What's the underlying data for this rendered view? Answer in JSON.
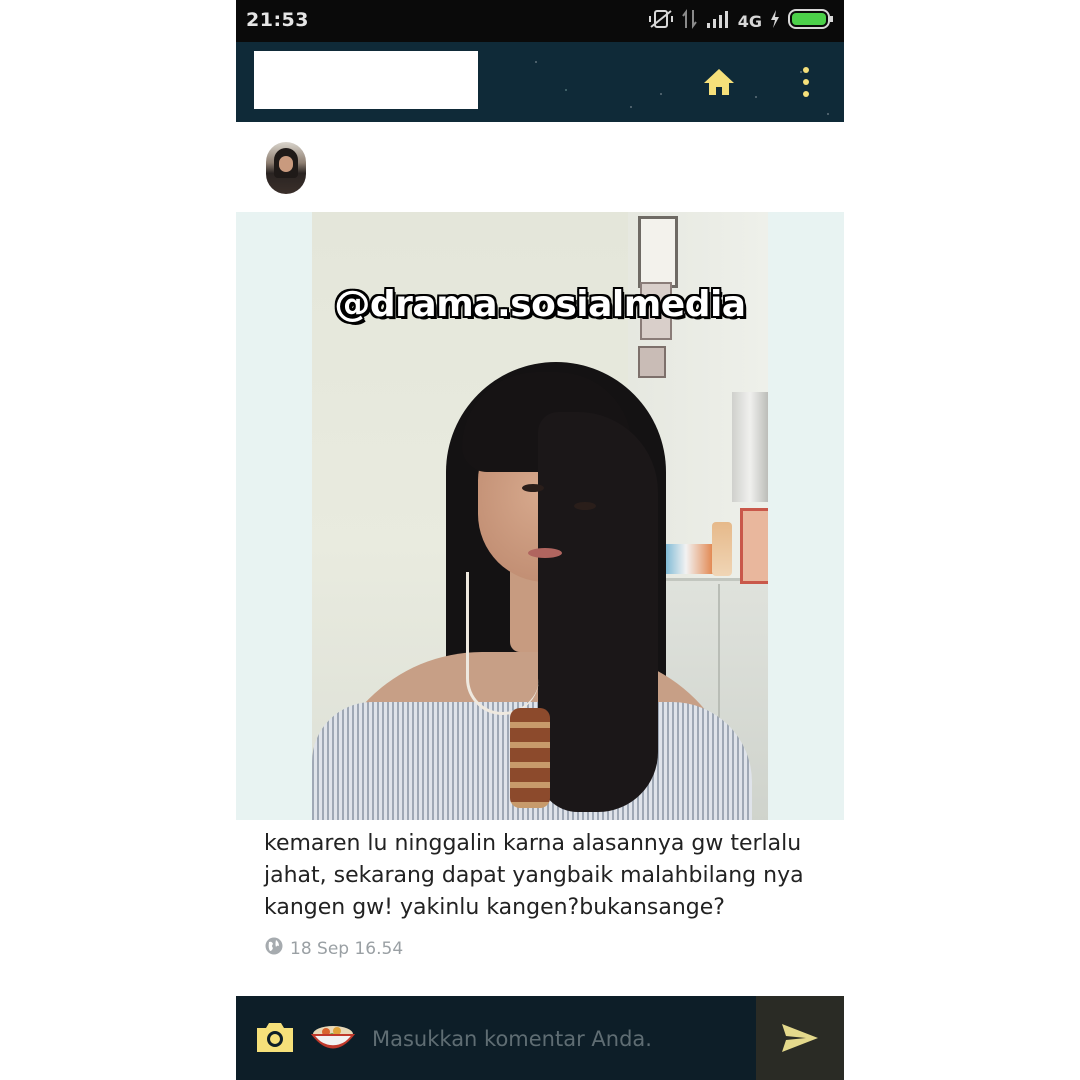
{
  "status_bar": {
    "time": "21:53",
    "network": "4G",
    "icons": [
      "mute-vibrate-icon",
      "data-arrows-icon",
      "signal-icon",
      "charging-icon",
      "battery-icon"
    ]
  },
  "app_bar": {
    "home_icon": "home-icon",
    "menu_icon": "more-vertical-icon",
    "colors": {
      "bar": "#0f2a38",
      "icon": "#f5e07a"
    }
  },
  "post": {
    "avatar_icon": "avatar",
    "watermark": "@drama.sosialmedia",
    "caption": "kemaren lu ninggalin karna alasannya gw terlalu jahat, sekarang dapat yangbaik malahbilang nya kangen gw! yakinlu kangen?bukansange?",
    "timestamp": "18 Sep 16.54",
    "visibility_icon": "globe-icon"
  },
  "comment_bar": {
    "placeholder": "Masukkan komentar Anda.",
    "camera_icon": "camera-icon",
    "emoji_icon": "emoji-bowl-icon",
    "send_icon": "send-icon"
  }
}
